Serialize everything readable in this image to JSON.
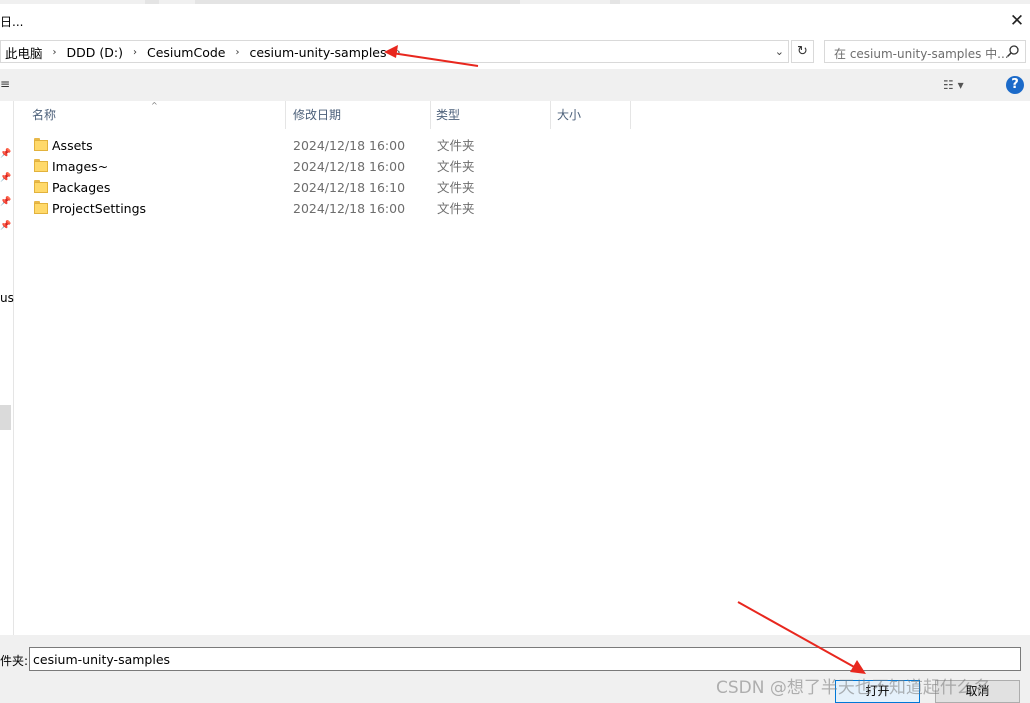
{
  "dialog": {
    "title": "日...",
    "close_glyph": "✕"
  },
  "address": {
    "crumbs": [
      "此电脑",
      "DDD (D:)",
      "CesiumCode",
      "cesium-unity-samples"
    ],
    "refresh_glyph": "↻",
    "dropdown_glyph": "⌄"
  },
  "search": {
    "placeholder": "在 cesium-unity-samples 中..."
  },
  "toolbar": {
    "left_glyph": "≡",
    "view_glyph": "☷ ▾",
    "help_label": "?"
  },
  "nav": {
    "partial_label": "us"
  },
  "columns": {
    "name": "名称",
    "date": "修改日期",
    "type": "类型",
    "size": "大小"
  },
  "files": [
    {
      "name": "Assets",
      "date": "2024/12/18 16:00",
      "type": "文件夹"
    },
    {
      "name": "Images~",
      "date": "2024/12/18 16:00",
      "type": "文件夹"
    },
    {
      "name": "Packages",
      "date": "2024/12/18 16:10",
      "type": "文件夹"
    },
    {
      "name": "ProjectSettings",
      "date": "2024/12/18 16:00",
      "type": "文件夹"
    }
  ],
  "footer": {
    "folder_label": "件夹:",
    "folder_value": "cesium-unity-samples",
    "open_label": "打开",
    "cancel_label": "取消",
    "watermark": "CSDN @想了半天也不知道起什么名"
  },
  "colors": {
    "accent": "#0078d7",
    "annotation_arrow": "#e8271e",
    "help_blue": "#1b6ac9",
    "folder_yellow": "#ffd96a"
  }
}
